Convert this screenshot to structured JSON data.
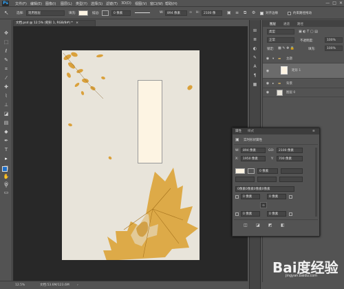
{
  "menubar": {
    "logo": "Ps",
    "items": [
      "文件(F)",
      "编辑(E)",
      "图像(I)",
      "图层(L)",
      "类型(Y)",
      "选择(S)",
      "滤镜(T)",
      "3D(D)",
      "视图(V)",
      "窗口(W)",
      "帮助(H)"
    ],
    "win_controls": [
      "—",
      "□",
      "✕"
    ]
  },
  "optionbar": {
    "select_label": "选择:",
    "select_value": "现用图层",
    "fill_label": "填充:",
    "stroke_label": "描边:",
    "stroke_value": "0 像素",
    "w_label": "W:",
    "w_value": "894 像素",
    "h_label": "H:",
    "h_value": "2100 像",
    "align_label": "对齐边缘",
    "constrain_label": "约束路径拖动"
  },
  "document": {
    "tab_title": "文档.psd @ 12.5% (矩形 1, RGB/8#) *",
    "tab_close": "×"
  },
  "status": {
    "zoom": "12.5%",
    "docinfo": "文档:53.6M/123.6M"
  },
  "layers_panel": {
    "tabs": [
      "图层",
      "通道",
      "路径"
    ],
    "kind": "类型",
    "mode": "正常",
    "opacity_label": "不透明度:",
    "opacity_value": "100%",
    "lock_label": "锁定:",
    "fill_label": "填充:",
    "fill_value": "100%",
    "layers": [
      {
        "name": "主题",
        "type": "group"
      },
      {
        "name": "矩形 1",
        "type": "shape"
      },
      {
        "name": "背景",
        "type": "group"
      },
      {
        "name": "图层 0",
        "type": "pixel"
      }
    ]
  },
  "properties_panel": {
    "tabs": [
      "属性",
      "样式"
    ],
    "title": "实时形状属性",
    "w_label": "W:",
    "w_value": "894 像素",
    "go_label": "GO:",
    "h_value": "2100 像素",
    "x_label": "X:",
    "x_value": "1950 像素",
    "y_label": "Y:",
    "y_value": "700 像素",
    "stroke_value": "0 像素",
    "radius_label": "0像素0像素0像素0像素",
    "corner_values": [
      "0 像素",
      "0 像素",
      "0 像素",
      "0 像素"
    ]
  },
  "watermark": {
    "brand": "Bai度经验",
    "url": "jingyan.baidu.com"
  },
  "colors": {
    "canvas_bg": "#282828",
    "doc_bg": "#e8e4da",
    "rect_fill": "#fdf4e3",
    "leaf": "#d99a2b",
    "ui_bg": "#535353",
    "accent": "#31a8ff"
  }
}
